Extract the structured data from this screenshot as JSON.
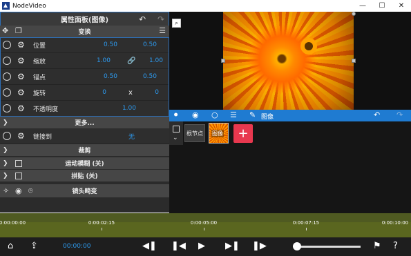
{
  "window": {
    "title": "NodeVideo",
    "controls": {
      "minimize": "—",
      "maximize": "☐",
      "close": "✕"
    }
  },
  "panel": {
    "title": "属性面板(图像)",
    "undo_icon": "undo-icon",
    "redo_icon": "redo-icon",
    "transform": {
      "label": "变换",
      "props": [
        {
          "label": "位置",
          "v1": "0.50",
          "v2": "0.50"
        },
        {
          "label": "缩放",
          "v1": "1.00",
          "v2": "1.00",
          "link_icon": "🔗"
        },
        {
          "label": "锚点",
          "v1": "0.50",
          "v2": "0.50"
        },
        {
          "label": "旋转",
          "v1": "0",
          "mid": "x",
          "v2": "0"
        },
        {
          "label": "不透明度",
          "v1": "1.00"
        }
      ]
    },
    "more_label": "更多...",
    "link_to": {
      "label": "链接到",
      "value": "无"
    },
    "crop_label": "裁剪",
    "motion_blur_label": "运动模糊 (关)",
    "tile_label": "拼贴 (关)",
    "lens_distort_label": "镜头畸变",
    "add_label": "+"
  },
  "viewer": {
    "zoom_icon": "magnifier-icon"
  },
  "node_toolbar": {
    "image_label": "图像"
  },
  "nodes": {
    "root_label": "根节点",
    "image_node_label": "图像",
    "add_label": "+"
  },
  "timeline": {
    "ticks": [
      "0:00:00:00",
      "0:00:02:15",
      "0:00:05:00",
      "0:00:07:15",
      "0:00:10:00"
    ]
  },
  "playbar": {
    "current_time": "00:00:00",
    "progress": 0.0
  },
  "colors": {
    "accent_blue": "#1f7bd1",
    "value_blue": "#2d9bf0",
    "add_red": "#e8384f",
    "timeline_olive": "#5a661f"
  }
}
